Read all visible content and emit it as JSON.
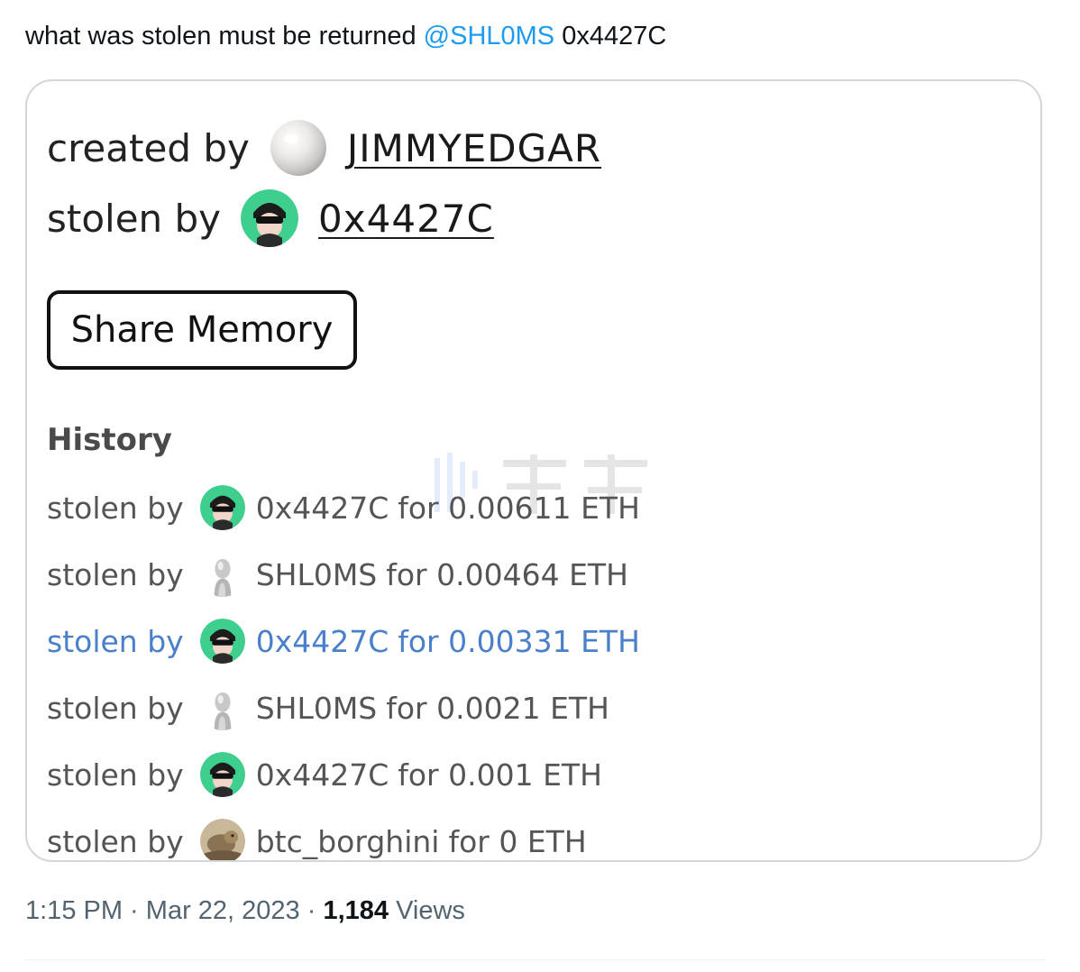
{
  "tweet": {
    "text_before": "what was stolen must be returned ",
    "mention": "@SHL0MS",
    "text_after": " 0x4427C"
  },
  "card": {
    "created_label": "created by",
    "creator": "JIMMYEDGAR",
    "stolen_label": "stolen by",
    "current_holder": "0x4427C",
    "share_button": "Share Memory",
    "history_title": "History",
    "history": [
      {
        "label": "stolen by",
        "user": "0x4427C",
        "amount": "for 0.00611 ETH",
        "avatar": "masked-character-icon"
      },
      {
        "label": "stolen by",
        "user": "SHL0MS",
        "amount": "for 0.00464 ETH",
        "avatar": "silver-figure-icon"
      },
      {
        "label": "stolen by",
        "user": "0x4427C",
        "amount": "for 0.00331 ETH",
        "avatar": "masked-character-icon"
      },
      {
        "label": "stolen by",
        "user": "SHL0MS",
        "amount": "for 0.0021 ETH",
        "avatar": "silver-figure-icon"
      },
      {
        "label": "stolen by",
        "user": "0x4427C",
        "amount": "for 0.001 ETH",
        "avatar": "masked-character-icon"
      },
      {
        "label": "stolen by",
        "user": "btc_borghini",
        "amount": "for 0 ETH",
        "avatar": "animal-photo-icon"
      }
    ]
  },
  "footer": {
    "time": "1:15 PM",
    "separator": " · ",
    "date": "Mar 22, 2023",
    "views_count": "1,184",
    "views_label": " Views"
  },
  "colors": {
    "mention": "#1d9bf0",
    "highlight_row": "#4a7fc9",
    "avatar_green": "#3ecf8e"
  }
}
